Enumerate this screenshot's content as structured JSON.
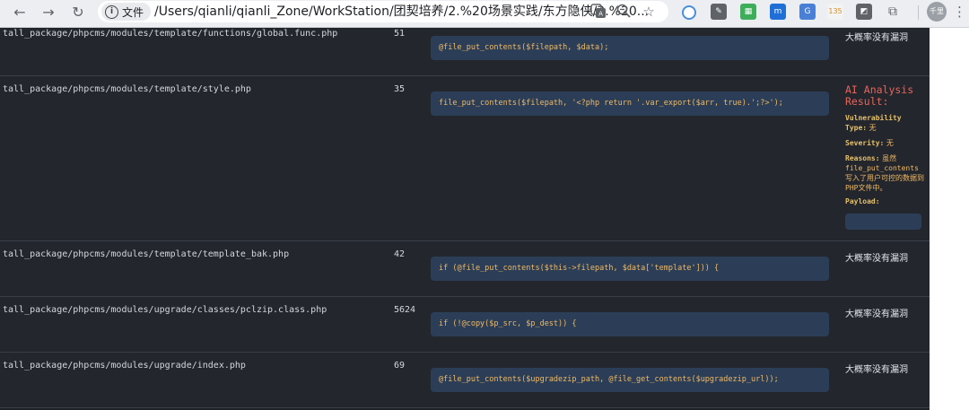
{
  "browser": {
    "file_chip": "文件",
    "url": "/Users/qianli/qianli_Zone/WorkStation/团契培养/2.%20场景实践/东方隐侠/3.%20...",
    "ext_icons": [
      "circle-ext",
      "edit-ext",
      "grid-ext",
      "m-ext",
      "translate-ext",
      "ext-135",
      "image-ext",
      "puzzle-ext"
    ],
    "profile_label": "千里"
  },
  "rows": [
    {
      "path": "tall_package/phpcms/modules/template/functions/global.func.php",
      "line": "51",
      "code": "@file_put_contents($filepath, $data);",
      "verdict": "大概率没有漏洞"
    },
    {
      "path": "tall_package/phpcms/modules/template/style.php",
      "line": "35",
      "code": "file_put_contents($filepath, '<?php return '.var_export($arr, true).';?>');",
      "ai": {
        "title": "AI Analysis Result:",
        "vuln_label": "Vulnerability Type:",
        "vuln_value": "无",
        "severity_label": "Severity:",
        "severity_value": "无",
        "reasons_label": "Reasons:",
        "reasons_value": "虽然 file_put_contents 写入了用户可控的数据到PHP文件中。",
        "payload_label": "Payload:"
      }
    },
    {
      "path": "tall_package/phpcms/modules/template/template_bak.php",
      "line": "42",
      "code": "if (@file_put_contents($this->filepath, $data['template'])) {",
      "verdict": "大概率没有漏洞"
    },
    {
      "path": "tall_package/phpcms/modules/upgrade/classes/pclzip.class.php",
      "line": "5624",
      "code": "if (!@copy($p_src, $p_dest)) {",
      "verdict": "大概率没有漏洞"
    },
    {
      "path": "tall_package/phpcms/modules/upgrade/index.php",
      "line": "69",
      "code": "@file_put_contents($upgradezip_path, @file_get_contents($upgradezip_url));",
      "verdict": "大概率没有漏洞"
    }
  ]
}
